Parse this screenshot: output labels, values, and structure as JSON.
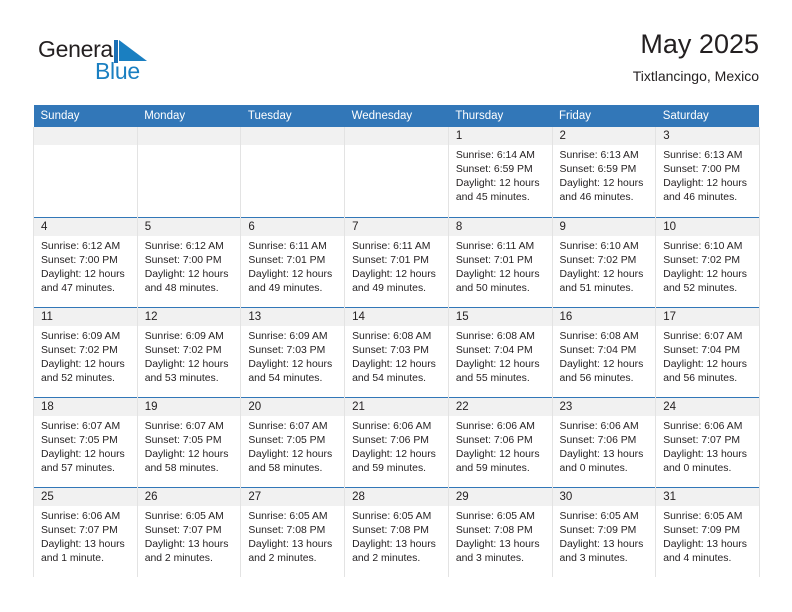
{
  "logo": {
    "word1": "General",
    "word2": "Blue",
    "flag_icon": "blue-triangle-flag",
    "accent_color": "#1a7fc1"
  },
  "header": {
    "title": "May 2025",
    "location": "Tixtlancingo, Mexico"
  },
  "theme": {
    "header_bg": "#3277b8",
    "daynum_bg": "#f1f1f1",
    "text": "#231f20"
  },
  "weekday_headers": [
    "Sunday",
    "Monday",
    "Tuesday",
    "Wednesday",
    "Thursday",
    "Friday",
    "Saturday"
  ],
  "weeks": [
    [
      {
        "day": "",
        "empty": true
      },
      {
        "day": "",
        "empty": true
      },
      {
        "day": "",
        "empty": true
      },
      {
        "day": "",
        "empty": true
      },
      {
        "day": "1",
        "sunrise": "Sunrise: 6:14 AM",
        "sunset": "Sunset: 6:59 PM",
        "daylight_1": "Daylight: 12 hours",
        "daylight_2": "and 45 minutes."
      },
      {
        "day": "2",
        "sunrise": "Sunrise: 6:13 AM",
        "sunset": "Sunset: 6:59 PM",
        "daylight_1": "Daylight: 12 hours",
        "daylight_2": "and 46 minutes."
      },
      {
        "day": "3",
        "sunrise": "Sunrise: 6:13 AM",
        "sunset": "Sunset: 7:00 PM",
        "daylight_1": "Daylight: 12 hours",
        "daylight_2": "and 46 minutes."
      }
    ],
    [
      {
        "day": "4",
        "sunrise": "Sunrise: 6:12 AM",
        "sunset": "Sunset: 7:00 PM",
        "daylight_1": "Daylight: 12 hours",
        "daylight_2": "and 47 minutes."
      },
      {
        "day": "5",
        "sunrise": "Sunrise: 6:12 AM",
        "sunset": "Sunset: 7:00 PM",
        "daylight_1": "Daylight: 12 hours",
        "daylight_2": "and 48 minutes."
      },
      {
        "day": "6",
        "sunrise": "Sunrise: 6:11 AM",
        "sunset": "Sunset: 7:01 PM",
        "daylight_1": "Daylight: 12 hours",
        "daylight_2": "and 49 minutes."
      },
      {
        "day": "7",
        "sunrise": "Sunrise: 6:11 AM",
        "sunset": "Sunset: 7:01 PM",
        "daylight_1": "Daylight: 12 hours",
        "daylight_2": "and 49 minutes."
      },
      {
        "day": "8",
        "sunrise": "Sunrise: 6:11 AM",
        "sunset": "Sunset: 7:01 PM",
        "daylight_1": "Daylight: 12 hours",
        "daylight_2": "and 50 minutes."
      },
      {
        "day": "9",
        "sunrise": "Sunrise: 6:10 AM",
        "sunset": "Sunset: 7:02 PM",
        "daylight_1": "Daylight: 12 hours",
        "daylight_2": "and 51 minutes."
      },
      {
        "day": "10",
        "sunrise": "Sunrise: 6:10 AM",
        "sunset": "Sunset: 7:02 PM",
        "daylight_1": "Daylight: 12 hours",
        "daylight_2": "and 52 minutes."
      }
    ],
    [
      {
        "day": "11",
        "sunrise": "Sunrise: 6:09 AM",
        "sunset": "Sunset: 7:02 PM",
        "daylight_1": "Daylight: 12 hours",
        "daylight_2": "and 52 minutes."
      },
      {
        "day": "12",
        "sunrise": "Sunrise: 6:09 AM",
        "sunset": "Sunset: 7:02 PM",
        "daylight_1": "Daylight: 12 hours",
        "daylight_2": "and 53 minutes."
      },
      {
        "day": "13",
        "sunrise": "Sunrise: 6:09 AM",
        "sunset": "Sunset: 7:03 PM",
        "daylight_1": "Daylight: 12 hours",
        "daylight_2": "and 54 minutes."
      },
      {
        "day": "14",
        "sunrise": "Sunrise: 6:08 AM",
        "sunset": "Sunset: 7:03 PM",
        "daylight_1": "Daylight: 12 hours",
        "daylight_2": "and 54 minutes."
      },
      {
        "day": "15",
        "sunrise": "Sunrise: 6:08 AM",
        "sunset": "Sunset: 7:04 PM",
        "daylight_1": "Daylight: 12 hours",
        "daylight_2": "and 55 minutes."
      },
      {
        "day": "16",
        "sunrise": "Sunrise: 6:08 AM",
        "sunset": "Sunset: 7:04 PM",
        "daylight_1": "Daylight: 12 hours",
        "daylight_2": "and 56 minutes."
      },
      {
        "day": "17",
        "sunrise": "Sunrise: 6:07 AM",
        "sunset": "Sunset: 7:04 PM",
        "daylight_1": "Daylight: 12 hours",
        "daylight_2": "and 56 minutes."
      }
    ],
    [
      {
        "day": "18",
        "sunrise": "Sunrise: 6:07 AM",
        "sunset": "Sunset: 7:05 PM",
        "daylight_1": "Daylight: 12 hours",
        "daylight_2": "and 57 minutes."
      },
      {
        "day": "19",
        "sunrise": "Sunrise: 6:07 AM",
        "sunset": "Sunset: 7:05 PM",
        "daylight_1": "Daylight: 12 hours",
        "daylight_2": "and 58 minutes."
      },
      {
        "day": "20",
        "sunrise": "Sunrise: 6:07 AM",
        "sunset": "Sunset: 7:05 PM",
        "daylight_1": "Daylight: 12 hours",
        "daylight_2": "and 58 minutes."
      },
      {
        "day": "21",
        "sunrise": "Sunrise: 6:06 AM",
        "sunset": "Sunset: 7:06 PM",
        "daylight_1": "Daylight: 12 hours",
        "daylight_2": "and 59 minutes."
      },
      {
        "day": "22",
        "sunrise": "Sunrise: 6:06 AM",
        "sunset": "Sunset: 7:06 PM",
        "daylight_1": "Daylight: 12 hours",
        "daylight_2": "and 59 minutes."
      },
      {
        "day": "23",
        "sunrise": "Sunrise: 6:06 AM",
        "sunset": "Sunset: 7:06 PM",
        "daylight_1": "Daylight: 13 hours",
        "daylight_2": "and 0 minutes."
      },
      {
        "day": "24",
        "sunrise": "Sunrise: 6:06 AM",
        "sunset": "Sunset: 7:07 PM",
        "daylight_1": "Daylight: 13 hours",
        "daylight_2": "and 0 minutes."
      }
    ],
    [
      {
        "day": "25",
        "sunrise": "Sunrise: 6:06 AM",
        "sunset": "Sunset: 7:07 PM",
        "daylight_1": "Daylight: 13 hours",
        "daylight_2": "and 1 minute."
      },
      {
        "day": "26",
        "sunrise": "Sunrise: 6:05 AM",
        "sunset": "Sunset: 7:07 PM",
        "daylight_1": "Daylight: 13 hours",
        "daylight_2": "and 2 minutes."
      },
      {
        "day": "27",
        "sunrise": "Sunrise: 6:05 AM",
        "sunset": "Sunset: 7:08 PM",
        "daylight_1": "Daylight: 13 hours",
        "daylight_2": "and 2 minutes."
      },
      {
        "day": "28",
        "sunrise": "Sunrise: 6:05 AM",
        "sunset": "Sunset: 7:08 PM",
        "daylight_1": "Daylight: 13 hours",
        "daylight_2": "and 2 minutes."
      },
      {
        "day": "29",
        "sunrise": "Sunrise: 6:05 AM",
        "sunset": "Sunset: 7:08 PM",
        "daylight_1": "Daylight: 13 hours",
        "daylight_2": "and 3 minutes."
      },
      {
        "day": "30",
        "sunrise": "Sunrise: 6:05 AM",
        "sunset": "Sunset: 7:09 PM",
        "daylight_1": "Daylight: 13 hours",
        "daylight_2": "and 3 minutes."
      },
      {
        "day": "31",
        "sunrise": "Sunrise: 6:05 AM",
        "sunset": "Sunset: 7:09 PM",
        "daylight_1": "Daylight: 13 hours",
        "daylight_2": "and 4 minutes."
      }
    ]
  ]
}
